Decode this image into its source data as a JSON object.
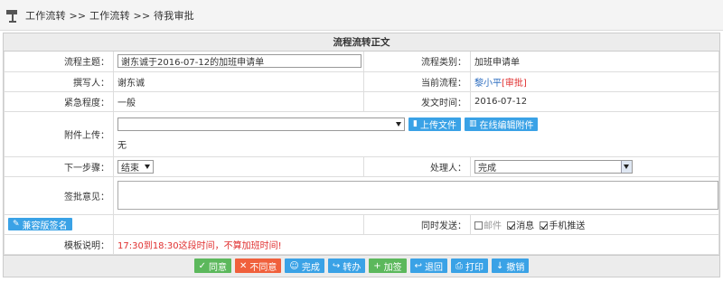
{
  "breadcrumb": "工作流转 >> 工作流转 >> 待我审批",
  "form": {
    "title": "流程流转正文",
    "subject_label": "流程主题：",
    "subject_value": "谢东诚于2016-07-12的加班申请单",
    "category_label": "流程类别：",
    "category_value": "加班申请单",
    "author_label": "撰写人：",
    "author_value": "谢东诚",
    "current_flow_label": "当前流程：",
    "current_flow_person": "黎小平",
    "current_flow_status": "[审批]",
    "urgency_label": "紧急程度：",
    "urgency_value": "一般",
    "send_time_label": "发文时间：",
    "send_time_value": "2016-07-12",
    "attachment_label": "附件上传：",
    "upload_button": "上传文件",
    "online_edit_button": "在线编辑附件",
    "attachment_value": "无",
    "next_step_label": "下一步骤：",
    "next_step_value": "结束",
    "handler_label": "处理人：",
    "handler_value": "完成",
    "opinion_label": "签批意见：",
    "compat_sign_button": "兼容版签名",
    "send_also_label": "同时发送：",
    "send_mail": "邮件",
    "send_message": "消息",
    "send_mobile": "手机推送",
    "template_label": "模板说明：",
    "template_value": "17:30到18:30这段时间，不算加班时间!"
  },
  "actions": {
    "agree": "同意",
    "disagree": "不同意",
    "complete": "完成",
    "forward": "转办",
    "add_sign": "加签",
    "return": "退回",
    "print": "打印",
    "revoke": "撤销"
  },
  "colors": {
    "primary_blue": "#3aa2e6",
    "green": "#5cb85c",
    "red": "#f0603c",
    "warning_text": "#e03030"
  }
}
